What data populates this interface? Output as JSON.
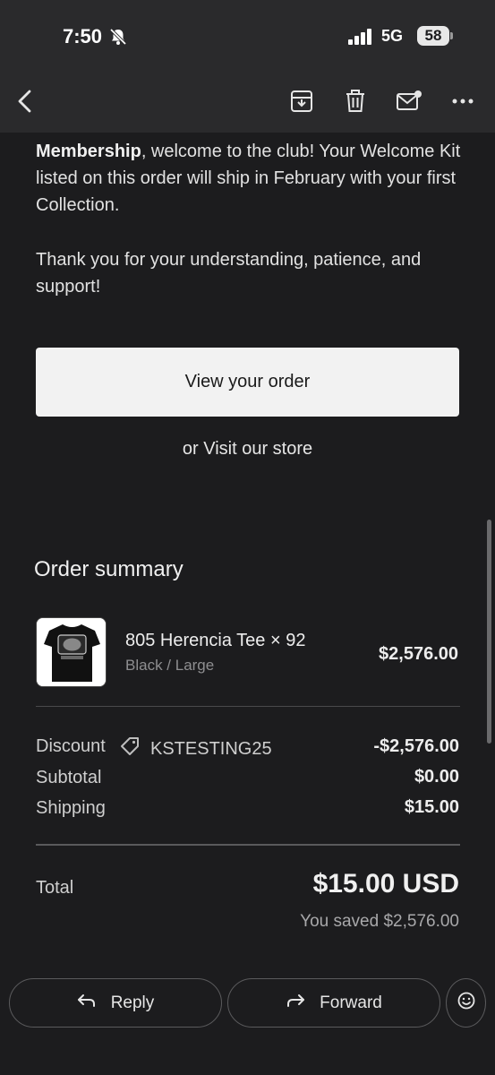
{
  "status": {
    "time": "7:50",
    "network": "5G",
    "battery": "58"
  },
  "overlay_text": "",
  "email": {
    "paragraph1_bold": "Membership",
    "paragraph1_rest": ", welcome to the club! Your Welcome Kit listed on this order will ship in February with your first Collection.",
    "paragraph2": "Thank you for your understanding, patience, and support!",
    "view_order_label": "View your order",
    "store_prefix": "or ",
    "store_link": "Visit our store"
  },
  "order_summary": {
    "title": "Order summary",
    "item": {
      "name": "805 Herencia Tee × 92",
      "variant": "Black / Large",
      "price": "$2,576.00"
    },
    "discount_label": "Discount",
    "discount_code": "KSTESTING25",
    "discount_value": "-$2,576.00",
    "subtotal_label": "Subtotal",
    "subtotal_value": "$0.00",
    "shipping_label": "Shipping",
    "shipping_value": "$15.00",
    "total_label": "Total",
    "total_value": "$15.00 USD",
    "saved_text": "You saved $2,576.00"
  },
  "actions": {
    "reply": "Reply",
    "forward": "Forward"
  },
  "icons": [
    "bell-slash-icon",
    "signal-icon",
    "back-arrow-icon",
    "archive-icon",
    "trash-icon",
    "mark-unread-icon",
    "more-icon",
    "tag-icon",
    "reply-icon",
    "forward-icon",
    "emoji-icon"
  ]
}
